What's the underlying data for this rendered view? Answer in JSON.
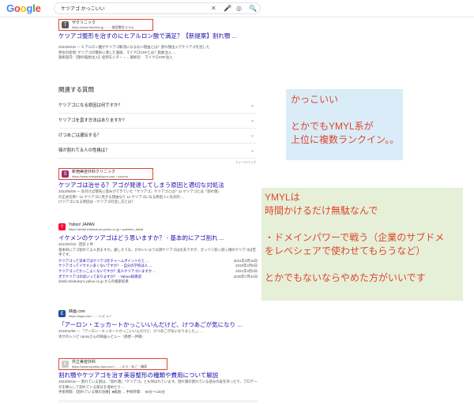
{
  "search": {
    "query": "ケツアゴ かっこいい"
  },
  "logo": [
    "G",
    "o",
    "o",
    "g",
    "l",
    "e"
  ],
  "icons": {
    "clear": "✕",
    "mic": "🎤",
    "lens": "◎",
    "search": "🔍"
  },
  "r1": {
    "site": "ザクリニック",
    "url": "https://www.theclinic.jp › ... › 美容整形コラム",
    "title": "ケツアゴ整形を治すのにヒアルロン酸で満足？【新提案】割れ顎 ...",
    "snip": [
      "2023/04/10 — ヒアルロン酸がケツアゴ解消になるない理由とは？割れ顎注入でケツアゴを治した",
      "男女の症例; ケツアゴの整形に適した施術、マイクロCRFとは？脂肪注入 ...",
      "施術案内：【顎の脂肪注入】症例モニター・... 施術名： マイクロCRF注入"
    ]
  },
  "related": {
    "heading": "関連する質問",
    "questions": [
      "ケツアゴになる原因は何ですか？",
      "ケツアゴを直す方法はありますか？",
      "けつあごは遺伝する？",
      "顎が割れてる人の性格は？"
    ],
    "feedback": "フィードバック"
  },
  "r2": {
    "site": "新宿美容外科クリニック",
    "url": "https://www.shinjukubiyou.com › column",
    "title": "ケツアゴは治せる？アゴが発達してしまう原因と適切な対処法",
    "snip": [
      "2023/06/05 — 気付けば顎先に窪みができていた「ケツアゴ」ケツアゴとは？11 ケツアゴとは「割れ顎」",
      "の正式名称！12 ケツアゴに見せる理由なり 12 ケツアゴになる原因 2 1 先天的 ...",
      "けツアゴになる原因は・ケツアゴの治し方とは？"
    ]
  },
  "r3": {
    "site": "Yahoo! JAPAN",
    "url": "https://detail.chiebukuro.yahoo.co.jp › question_detail",
    "title": "イケメンのケツアゴはどう思いますか？ - 基本的にアゴ割れ ...",
    "snip": [
      "2012/02/15 · 回答 2 件",
      "基本的にアゴ割れてる人見ますか。通しそうな、かわいいような顔ケツアゴは丈夫ですが、ガッツリ割っ割っ顔のケツアゴは苦手です。"
    ],
    "rows": [
      [
        "ケツアゴって日本ではケツアゴをチャームポイントだと ...",
        "2021年3月15日"
      ],
      [
        "ケツアゴってイケメン多くないですか？ - 自分の学校は人 ...",
        "2019年2月6日"
      ],
      [
        "ケツアゴってかっこよくないですか？美人ケツアゴいますか ...",
        "2021年4月3日"
      ],
      [
        "犬でケツアゴの良いってありますか？ - Yahoo!知恵袋",
        "2020年7月24日"
      ]
    ],
    "more": "detail.chiebukuro.yahoo.co.jp からの検索結果"
  },
  "r4": {
    "site": "映画.com",
    "url": "https://eiga.com › ... › レビュー",
    "title": "「アーロン・エッカートかっこいいんだけど、けつあごが気になり ...",
    "snip": [
      "2019/11/05 — 「アーロン・エッカートかっこいいんだけど、けつあごが気になりました。」...",
      "幸せのレシピ cannyさんの映画レビュー（感想・評価）"
    ]
  },
  "r5": {
    "site": "共立美容外科",
    "url": "https://www.kyoritsu-biyo.com › ... › エラ・あご・輪郭",
    "title": "割れ顎やケツアゴを治す美容整形の種類や費用について解説",
    "snip": [
      "2023/06/15 — 割れている割は、「割れ顎」「ケツアゴ」とも呼ばれています。割れ顎の割れている部分の皮を持ったり、プロテーゼを挿入して割れている部分を埋めたり ...",
      "手術時間：【割れている顎の治療】■脂肪 ...   手術時間：　60分〜120分"
    ]
  },
  "notes": {
    "n1": [
      "かっこいい",
      "",
      "とかでもYMYL系が",
      "上位に複数ランクイン。。"
    ],
    "n2": [
      "YMYLは",
      "時間かけるだけ無駄なんで",
      "",
      "・ドメインパワーで戦う（企業のサブドメ",
      "をレベシェアで使わせてもらうなど）",
      "",
      "とかでもないならやめた方がいいです"
    ]
  }
}
